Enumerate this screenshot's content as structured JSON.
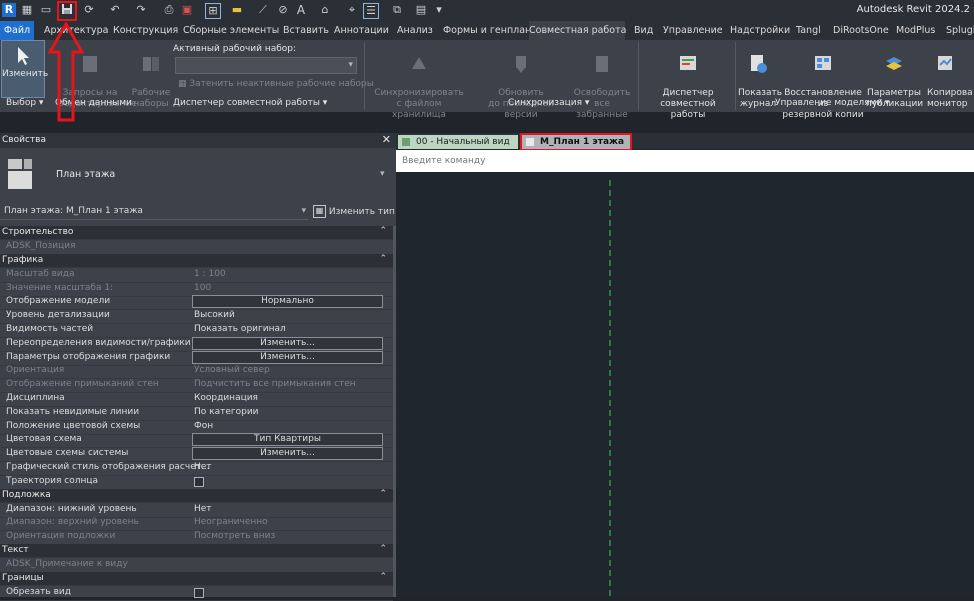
{
  "app_title": "Autodesk Revit 2024.2",
  "quick_access": {
    "icons": [
      "revit-logo-icon",
      "open-icon",
      "save-icon",
      "sync-icon",
      "undo-icon",
      "redo-icon",
      "print-icon",
      "close-view-icon",
      "thin-lines-icon",
      "measure-icon",
      "dimension-icon",
      "tag-icon",
      "text-icon",
      "3d-view-icon",
      "section-icon",
      "switch-windows-icon",
      "close-hidden-icon",
      "customize-icon"
    ]
  },
  "menu_tabs": [
    "Файл",
    "Архитектура",
    "Конструкция",
    "Сборные элементы",
    "Вставить",
    "Аннотации",
    "Анализ",
    "Формы и генплан",
    "Совместная работа",
    "Вид",
    "Управление",
    "Надстройки",
    "Tangl",
    "DiRootsOne",
    "ModPlus",
    "Splugi"
  ],
  "ribbon": {
    "modify": "Изменить",
    "requests": "Запросы на\nредактирование",
    "worksets": "Рабочие\nнаборы",
    "active_workset_label": "Активный рабочий набор:",
    "gray_inactive": "Затенить неактивные рабочие наборы",
    "sync": "Синхронизировать\nс файлом хранилища",
    "reload": "Обновить\nдо последней версии",
    "relinquish": "Освободить\nвсе забранные",
    "worksharing_monitor": "Диспетчер\nсовместной работы",
    "show_history": "Показать\nжурнал",
    "restore_backup": "Восстановление из\nрезервной копии",
    "publish_settings": "Параметры\nпубликации",
    "copy_monitor": "Копирова\nмонитор",
    "panels": {
      "select": "Выбор ▾",
      "exchange": "Обмен данными",
      "worksharing": "Диспетчер совместной работы ▾",
      "sync": "Синхронизация ▾",
      "manage_models": "Управление моделями ▾"
    }
  },
  "properties": {
    "title": "Свойства",
    "type_name": "План этажа",
    "selector": "План этажа: М_План 1 этажа",
    "edit_type": "Изменить тип",
    "rows": [
      {
        "kind": "cat",
        "label": "Строительство"
      },
      {
        "kind": "row",
        "label": "ADSK_Позиция",
        "value": "",
        "disabled": true
      },
      {
        "kind": "cat",
        "label": "Графика"
      },
      {
        "kind": "row",
        "label": "Масштаб вида",
        "value": "1 : 100",
        "disabled": true
      },
      {
        "kind": "row",
        "label": "Значение масштаба    1:",
        "value": "100",
        "disabled": true
      },
      {
        "kind": "box",
        "label": "Отображение модели",
        "value": "Нормально",
        "disabled": false
      },
      {
        "kind": "row",
        "label": "Уровень детализации",
        "value": "Высокий",
        "disabled": false
      },
      {
        "kind": "row",
        "label": "Видимость частей",
        "value": "Показать оригинал",
        "disabled": false
      },
      {
        "kind": "box",
        "label": "Переопределения видимости/графики",
        "value": "Изменить...",
        "disabled": false
      },
      {
        "kind": "box",
        "label": "Параметры отображения графики",
        "value": "Изменить...",
        "disabled": false
      },
      {
        "kind": "row",
        "label": "Ориентация",
        "value": "Условный север",
        "disabled": true
      },
      {
        "kind": "row",
        "label": "Отображение примыканий стен",
        "value": "Подчистить все примыкания стен",
        "disabled": true
      },
      {
        "kind": "row",
        "label": "Дисциплина",
        "value": "Координация",
        "disabled": false
      },
      {
        "kind": "row",
        "label": "Показать невидимые линии",
        "value": "По категории",
        "disabled": false
      },
      {
        "kind": "row",
        "label": "Положение цветовой схемы",
        "value": "Фон",
        "disabled": false
      },
      {
        "kind": "box",
        "label": "Цветовая схема",
        "value": "Тип Квартиры",
        "disabled": false
      },
      {
        "kind": "box",
        "label": "Цветовые схемы системы",
        "value": "Изменить...",
        "disabled": false
      },
      {
        "kind": "row",
        "label": "Графический стиль отображения расчет...",
        "value": "Нет",
        "disabled": false
      },
      {
        "kind": "chk",
        "label": "Траектория солнца",
        "value": "",
        "disabled": false
      },
      {
        "kind": "cat",
        "label": "Подложка"
      },
      {
        "kind": "row",
        "label": "Диапазон: нижний уровень",
        "value": "Нет",
        "disabled": false
      },
      {
        "kind": "row",
        "label": "Диапазон: верхний уровень",
        "value": "Неограниченно",
        "disabled": true
      },
      {
        "kind": "row",
        "label": "Ориентация подложки",
        "value": "Посмотреть вниз",
        "disabled": true
      },
      {
        "kind": "cat",
        "label": "Текст"
      },
      {
        "kind": "row",
        "label": "ADSK_Примечание к виду",
        "value": "",
        "disabled": true
      },
      {
        "kind": "cat",
        "label": "Границы"
      },
      {
        "kind": "chk",
        "label": "Обрезать вид",
        "value": "",
        "disabled": false
      }
    ]
  },
  "view_tabs": {
    "start": "00 - Начальный вид",
    "floor": "М_План 1 этажа"
  },
  "command_placeholder": "Введите команду",
  "colors": {
    "accent_red": "#e8141c",
    "file_tab": "#1e6fd0",
    "guide_line": "#3ecf4e"
  }
}
